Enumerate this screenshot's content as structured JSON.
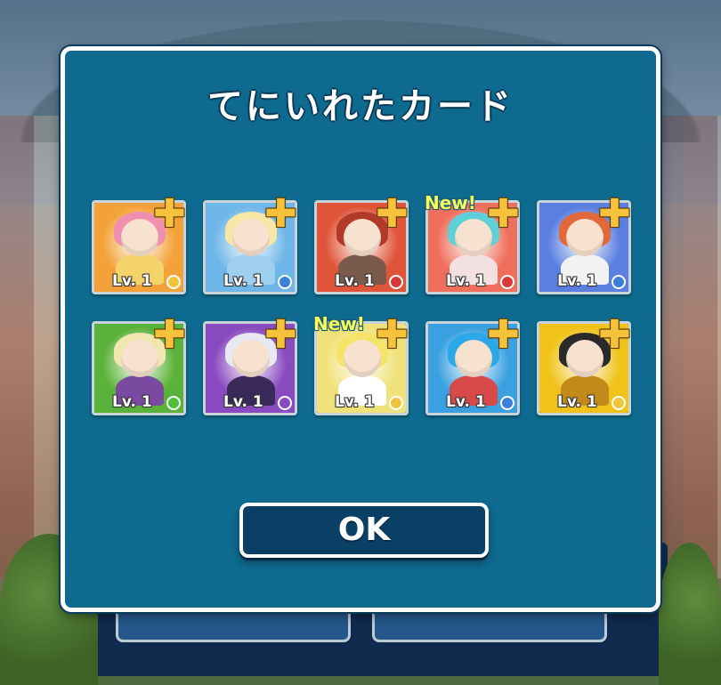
{
  "dialog": {
    "title": "てにいれたカード",
    "ok_label": "OK"
  },
  "cards": [
    {
      "level": "Lv. 1",
      "is_new": false,
      "new_label": "",
      "theme": "#f3a23a",
      "hair": "#f08fb0",
      "body": "#f4d36a",
      "element": "#f0c53a"
    },
    {
      "level": "Lv. 1",
      "is_new": false,
      "new_label": "",
      "theme": "#6fb7e8",
      "hair": "#f7e6a6",
      "body": "#9fd0f0",
      "element": "#3a7fd8"
    },
    {
      "level": "Lv. 1",
      "is_new": false,
      "new_label": "",
      "theme": "#e0553a",
      "hair": "#b23a2a",
      "body": "#7a5a4a",
      "element": "#d83a3a"
    },
    {
      "level": "Lv. 1",
      "is_new": true,
      "new_label": "New!",
      "theme": "#ef6f5c",
      "hair": "#5fcfd8",
      "body": "#f3e0e0",
      "element": "#d83a3a"
    },
    {
      "level": "Lv. 1",
      "is_new": false,
      "new_label": "",
      "theme": "#5a7fe0",
      "hair": "#e0683a",
      "body": "#f2f2f2",
      "element": "#3a7fd8"
    },
    {
      "level": "Lv. 1",
      "is_new": false,
      "new_label": "",
      "theme": "#5bb23a",
      "hair": "#f2e6b0",
      "body": "#7a4aa0",
      "element": "#4fbf3a"
    },
    {
      "level": "Lv. 1",
      "is_new": false,
      "new_label": "",
      "theme": "#8a4ac0",
      "hair": "#e8e8f0",
      "body": "#3a2a5a",
      "element": "#8a4ac0"
    },
    {
      "level": "Lv. 1",
      "is_new": true,
      "new_label": "New!",
      "theme": "#f0e27a",
      "hair": "#f4e46a",
      "body": "#ffffff",
      "element": "#f0c53a"
    },
    {
      "level": "Lv. 1",
      "is_new": false,
      "new_label": "",
      "theme": "#3aa0e0",
      "hair": "#2aa8e8",
      "body": "#d84a4a",
      "element": "#3a7fd8"
    },
    {
      "level": "Lv. 1",
      "is_new": false,
      "new_label": "",
      "theme": "#f0c21a",
      "hair": "#2a2a2a",
      "body": "#c28a1a",
      "element": "#f0c53a"
    }
  ]
}
